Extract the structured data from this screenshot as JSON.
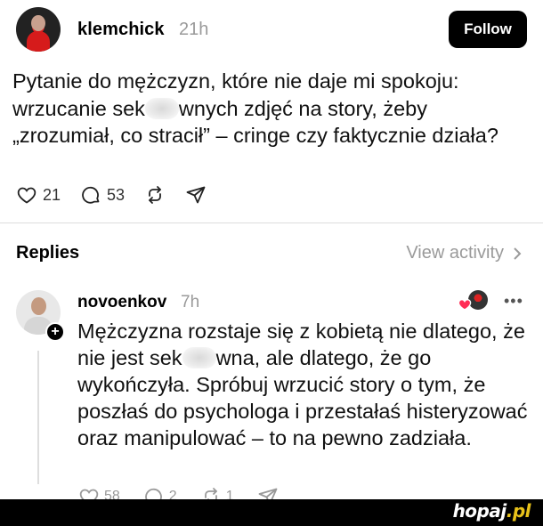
{
  "post": {
    "username": "klemchick",
    "time": "21h",
    "follow_label": "Follow",
    "text_part1": "Pytanie do mężczyzn, które nie daje mi spokoju: wrzucanie sek",
    "text_part2": "wnych zdjęć na story, żeby „zrozumiał, co stracił” – cringe czy faktycznie działa?",
    "likes": "21",
    "comments": "53"
  },
  "replies_section": {
    "label": "Replies",
    "view_activity": "View activity"
  },
  "reply": {
    "username": "novoenkov",
    "time": "7h",
    "text_part1": "Mężczyzna rozstaje się z kobietą nie dlatego, że nie jest sek",
    "text_part2": "wna, ale dlatego, że go wykończyła. Spróbuj wrzucić story o tym, że poszłaś do psychologa i przestałaś histeryzować oraz manipulować – to na pewno zadziała.",
    "likes": "58",
    "comments": "2",
    "reposts": "1"
  },
  "watermark": {
    "brand": "hopaj",
    "tld": ".pl"
  },
  "icons": [
    "heart-icon",
    "comment-icon",
    "repost-icon",
    "share-icon",
    "chevron-right-icon",
    "more-icon",
    "plus-icon"
  ]
}
